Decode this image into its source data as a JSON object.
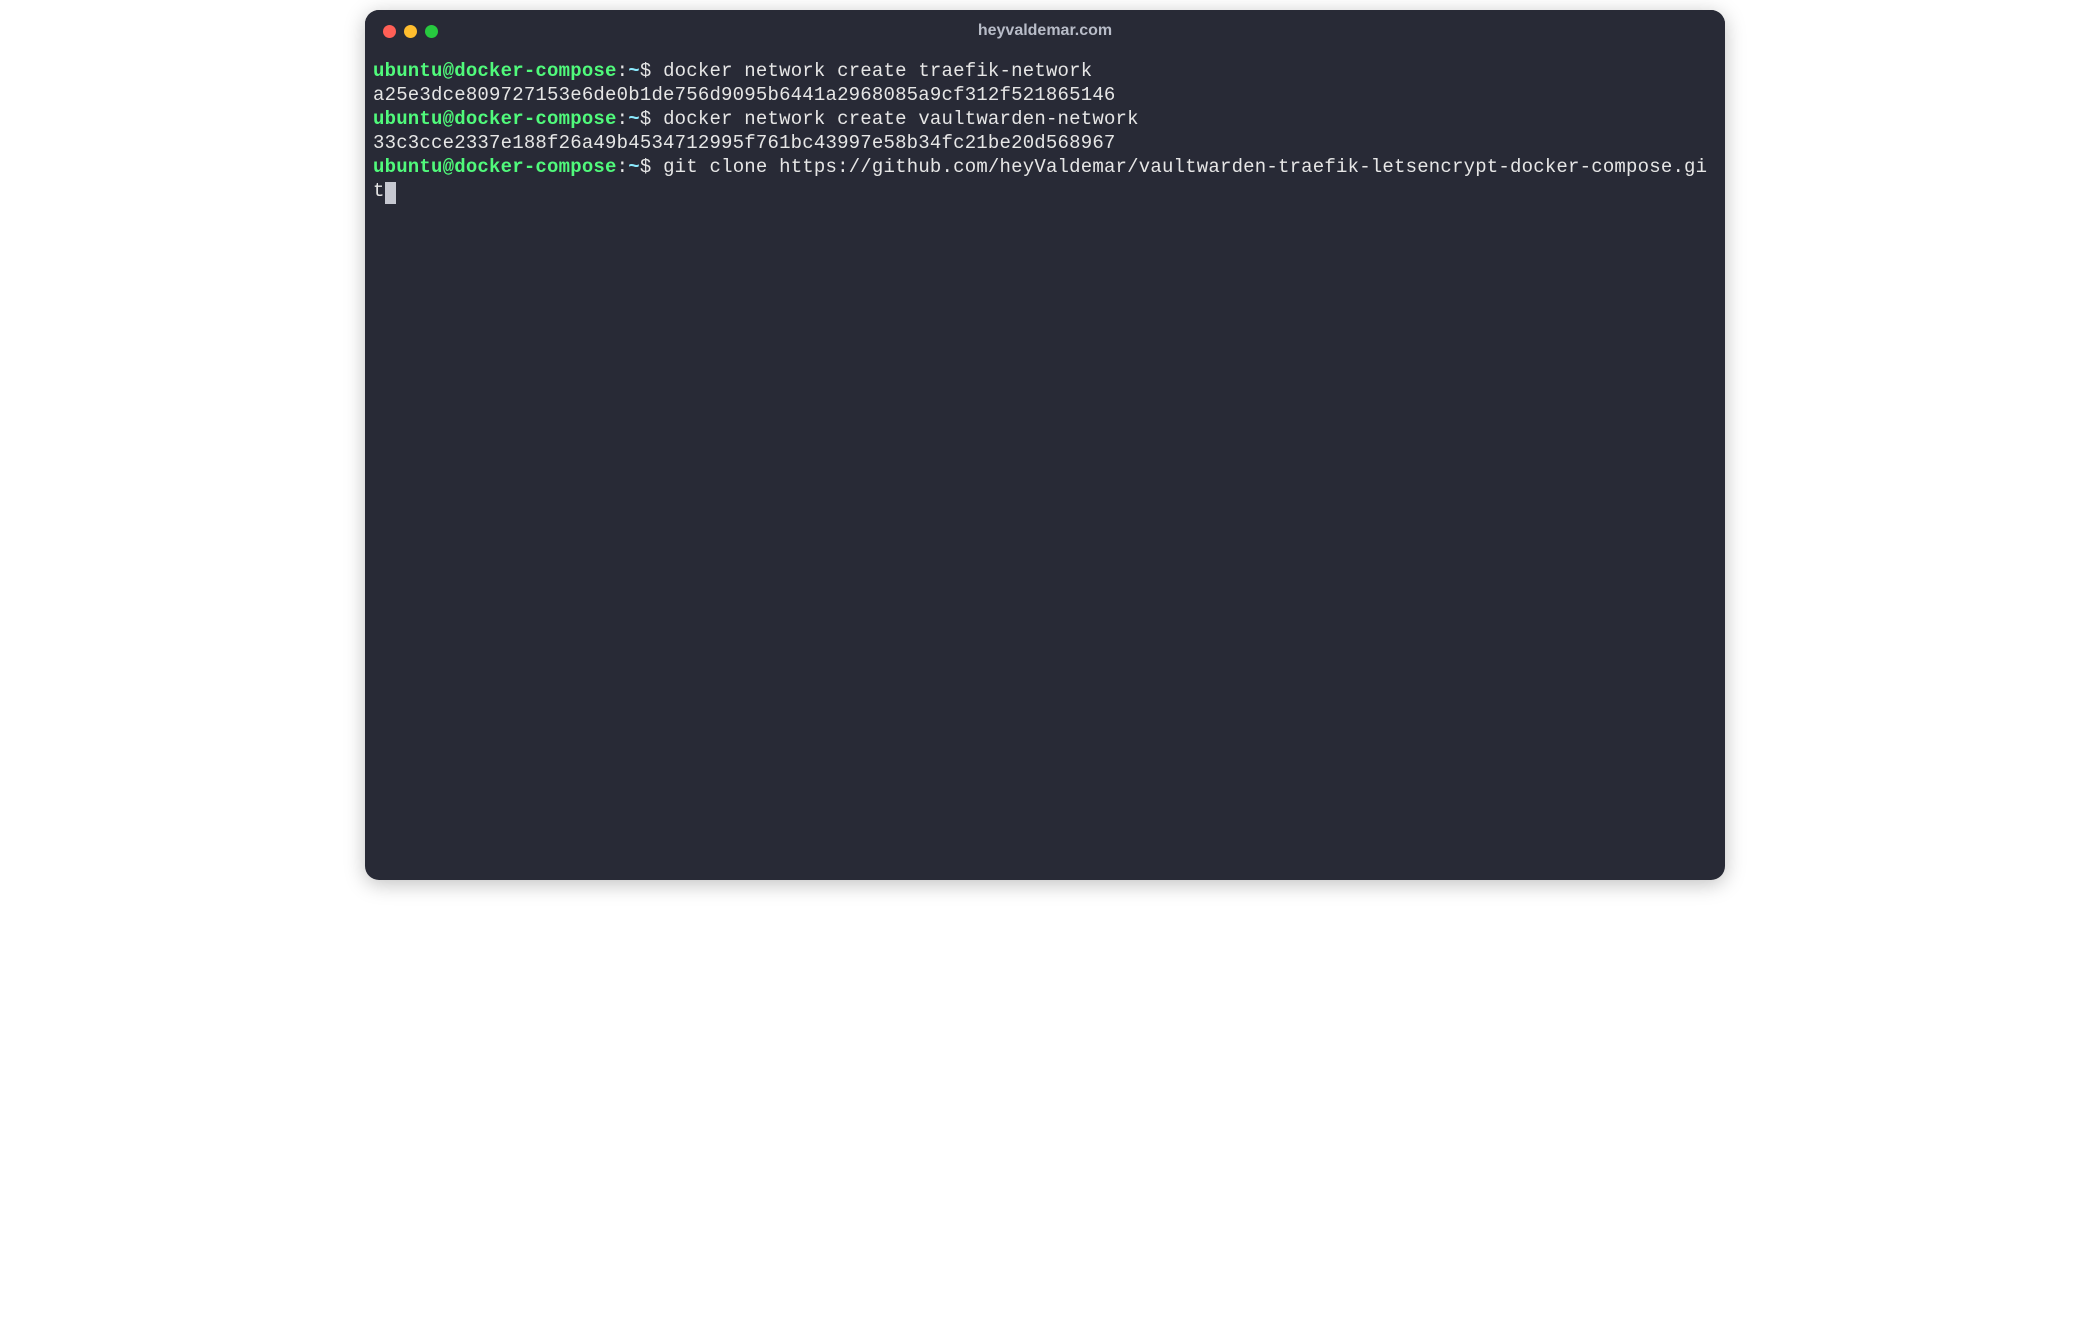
{
  "window": {
    "title": "heyvaldemar.com"
  },
  "prompt": {
    "user_host": "ubuntu@docker-compose",
    "separator": ":",
    "path": "~",
    "symbol": "$"
  },
  "lines": {
    "cmd1": "docker network create traefik-network",
    "out1": "a25e3dce809727153e6de0b1de756d9095b6441a2968085a9cf312f521865146",
    "cmd2": "docker network create vaultwarden-network",
    "out2": "33c3cce2337e188f26a49b4534712995f761bc43997e58b34fc21be20d568967",
    "cmd3": "git clone https://github.com/heyValdemar/vaultwarden-traefik-letsencrypt-docker-compose.git"
  }
}
